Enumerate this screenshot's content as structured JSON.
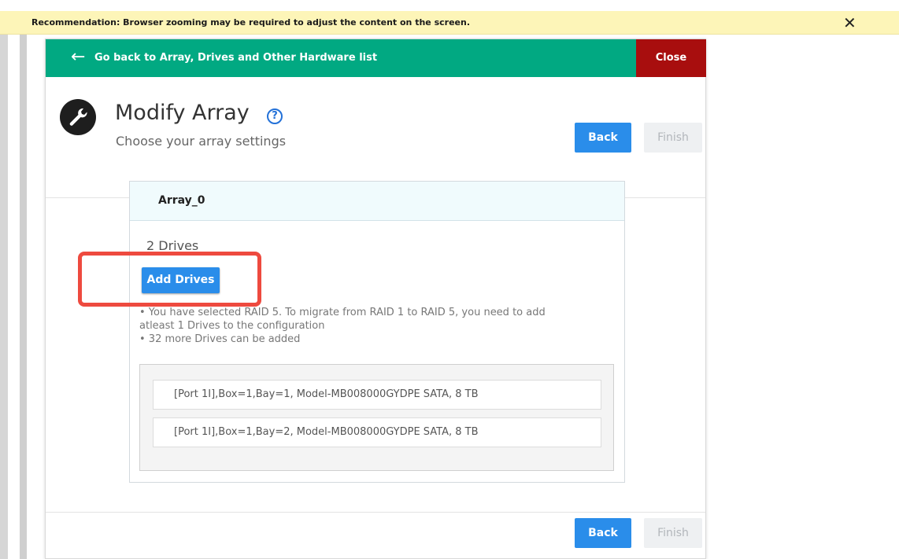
{
  "banner": {
    "text": "Recommendation: Browser zooming may be required to adjust the content on the screen.",
    "close_glyph": "✕"
  },
  "nav": {
    "back_arrow": "←",
    "back_label": "Go back to Array, Drives and Other Hardware list",
    "close_label": "Close"
  },
  "header": {
    "title": "Modify Array",
    "help_glyph": "?",
    "subtitle": "Choose your array settings",
    "back_label": "Back",
    "finish_label": "Finish"
  },
  "array": {
    "name": "Array_0",
    "drive_count": "2  Drives",
    "add_button_label": "Add Drives",
    "notes": [
      "• You have selected RAID 5. To migrate from RAID 1 to RAID 5, you need to add",
      "atleast 1 Drives to the configuration",
      "• 32 more Drives can be added"
    ],
    "drives": [
      "[Port 1I],Box=1,Bay=1, Model-MB008000GYDPE SATA, 8 TB",
      "[Port 1I],Box=1,Bay=2, Model-MB008000GYDPE SATA, 8 TB"
    ]
  },
  "footer": {
    "back_label": "Back",
    "finish_label": "Finish"
  },
  "colors": {
    "nav_green": "#01a982",
    "close_red": "#a80e0e",
    "primary_blue": "#2a8dea",
    "highlight_red": "#ee4a3f",
    "banner_yellow": "#fdf5b8"
  },
  "icons": {
    "header": "wrench-icon",
    "help": "help-icon",
    "nav": "arrow-left-icon",
    "banner_close": "close-icon"
  }
}
